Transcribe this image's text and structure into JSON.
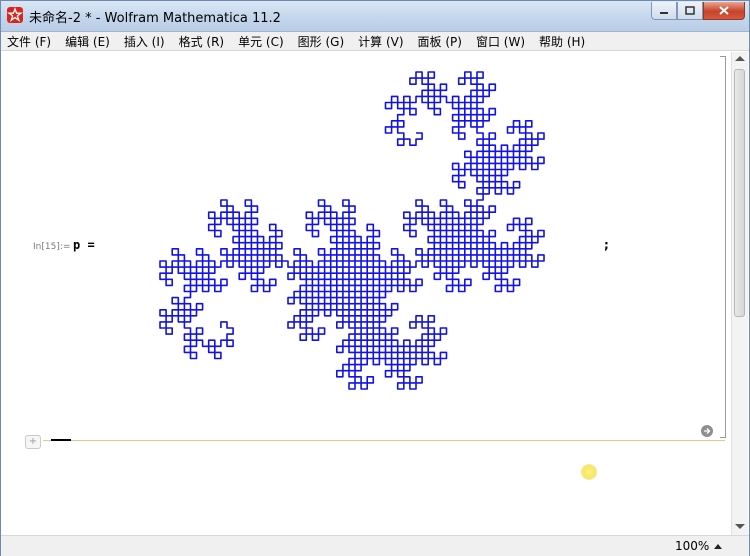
{
  "window": {
    "title": "未命名-2 * - Wolfram Mathematica 11.2"
  },
  "menu": {
    "items": [
      "文件 (F)",
      "编辑 (E)",
      "插入 (I)",
      "格式 (R)",
      "单元 (C)",
      "图形 (G)",
      "计算 (V)",
      "面板 (P)",
      "窗口 (W)",
      "帮助 (H)"
    ]
  },
  "cell": {
    "label": "In[15]:=",
    "code": "p =",
    "terminator": ";"
  },
  "colors": {
    "fractal": "#1212e6",
    "titlebar": "#c4d6ec"
  },
  "icons": {
    "app": "mathematica-icon",
    "minimize": "minimize-icon",
    "maximize": "maximize-icon",
    "close": "close-icon",
    "add_cell": "add-cell-icon",
    "evaluate": "arrow-right-icon"
  },
  "status": {
    "zoom": "100%"
  },
  "fractal": {
    "iterations": 11
  }
}
